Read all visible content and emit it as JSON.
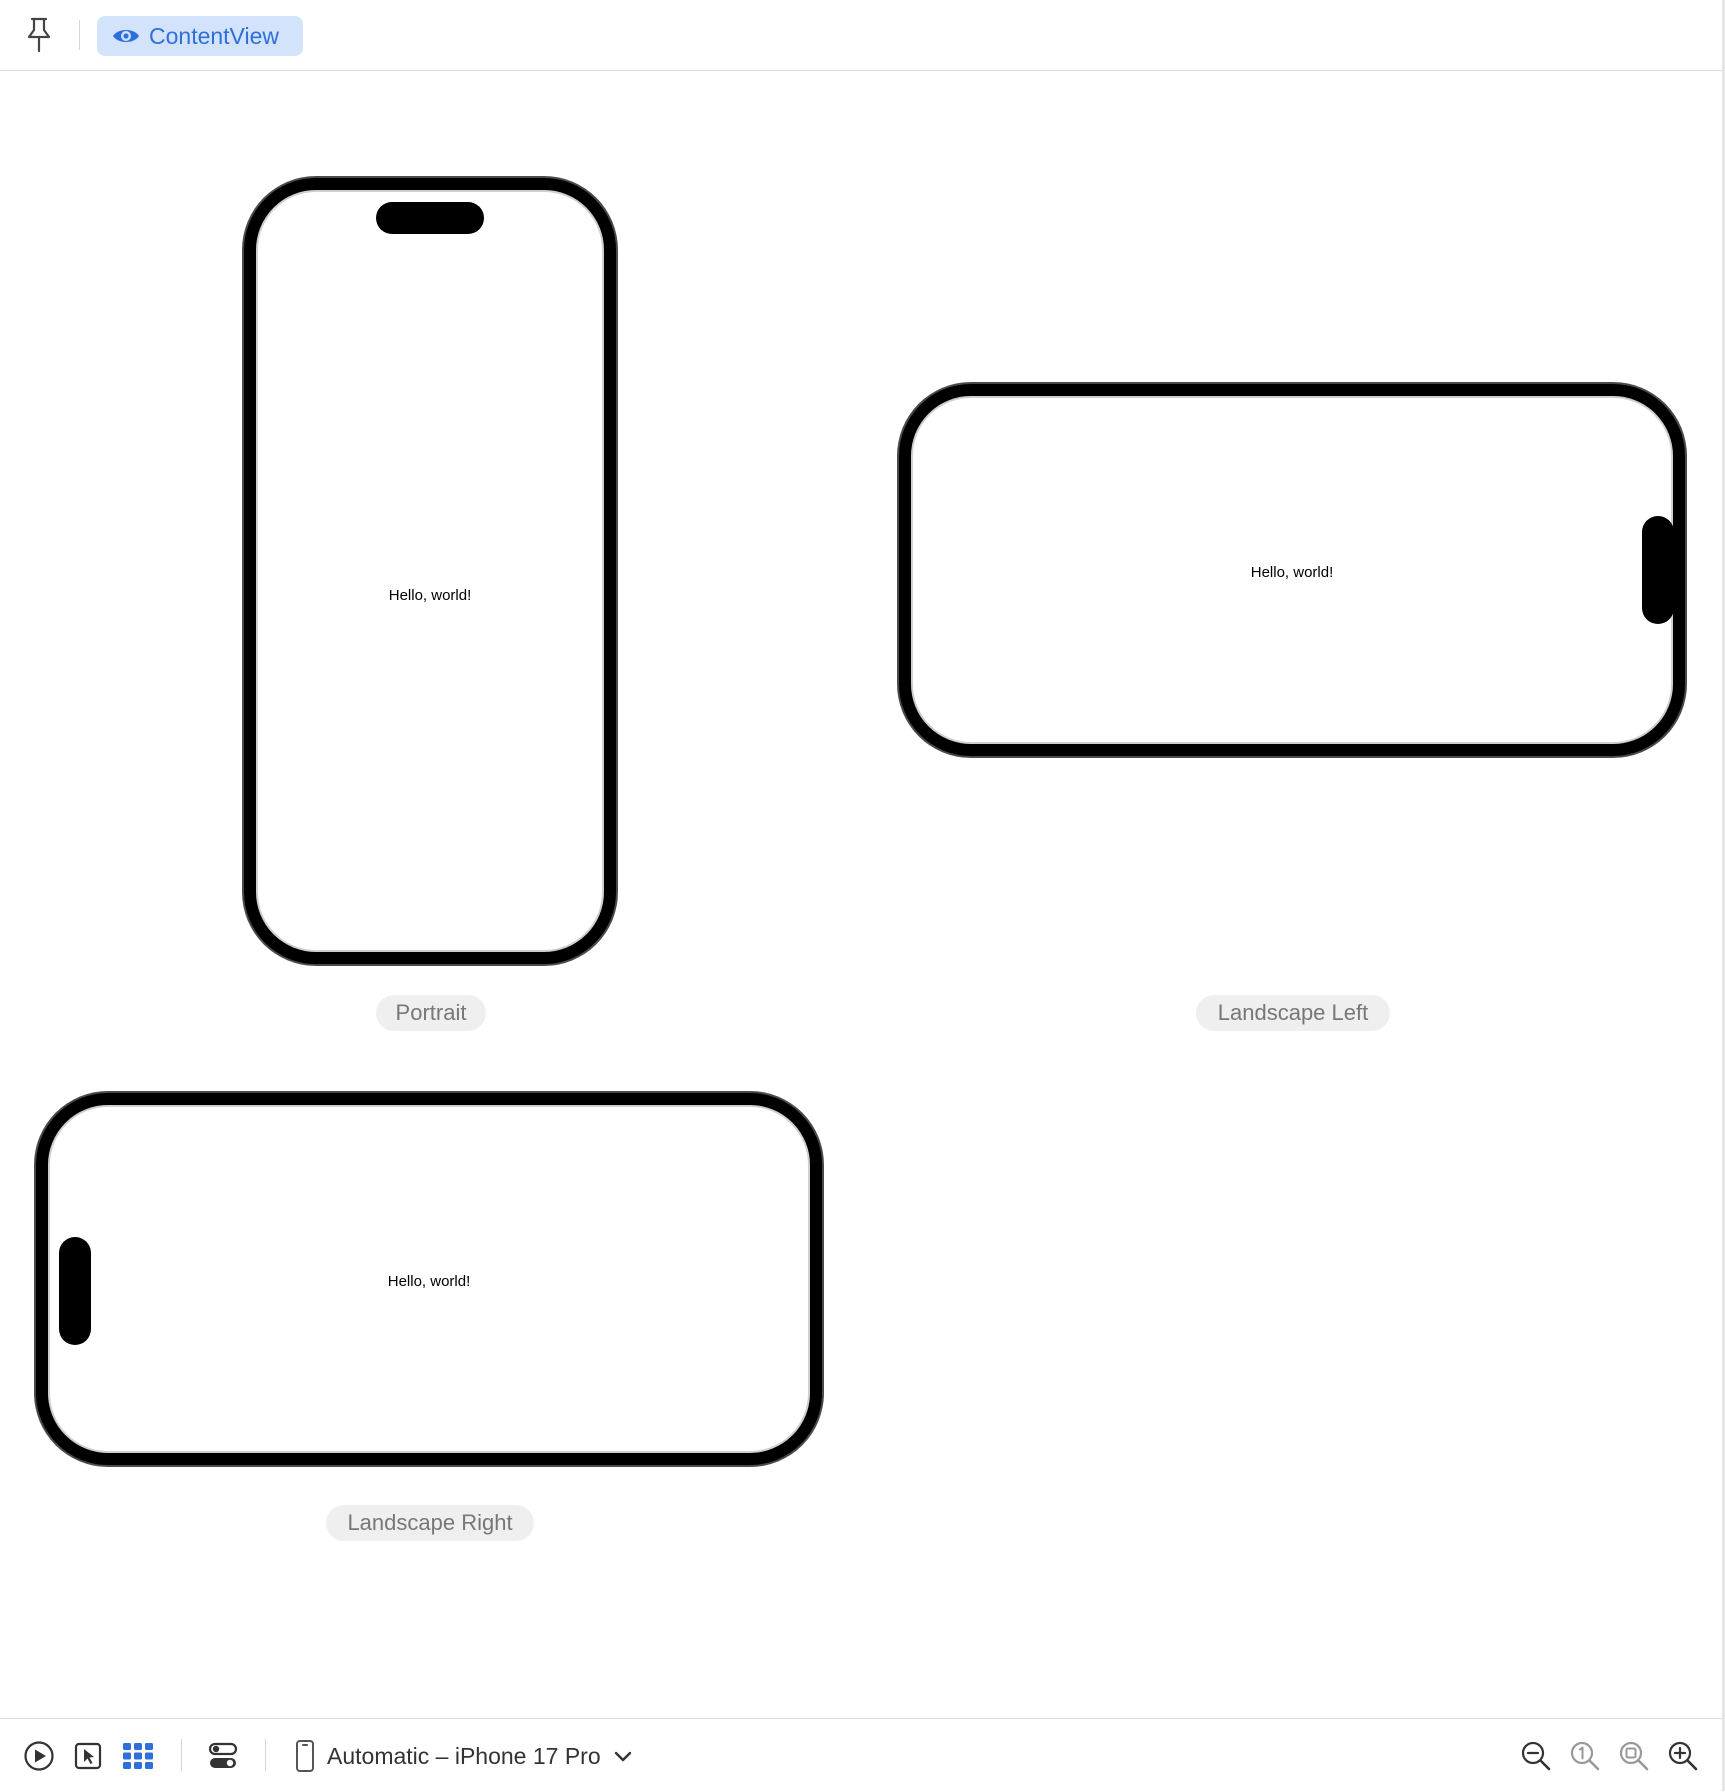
{
  "toolbar": {
    "pin_icon": "pin-icon",
    "preview_tab": {
      "label": "ContentView",
      "icon": "eye-icon",
      "accent": "#2f6fdc",
      "background": "#d3e3fb"
    }
  },
  "previews": [
    {
      "label": "Portrait",
      "text": "Hello, world!"
    },
    {
      "label": "Landscape Left",
      "text": "Hello, world!"
    },
    {
      "label": "Landscape Right",
      "text": "Hello, world!"
    }
  ],
  "bottom_toolbar": {
    "icons": [
      "play-icon",
      "select-cursor-icon",
      "grid-variants-icon",
      "device-settings-icon"
    ],
    "device_selector": {
      "label": "Automatic – iPhone 17 Pro",
      "icon": "iphone-icon"
    },
    "zoom_icons": [
      "zoom-out-icon",
      "zoom-actual-size-icon",
      "zoom-to-fit-icon",
      "zoom-in-icon"
    ],
    "active_color": "#2f6fdc"
  }
}
